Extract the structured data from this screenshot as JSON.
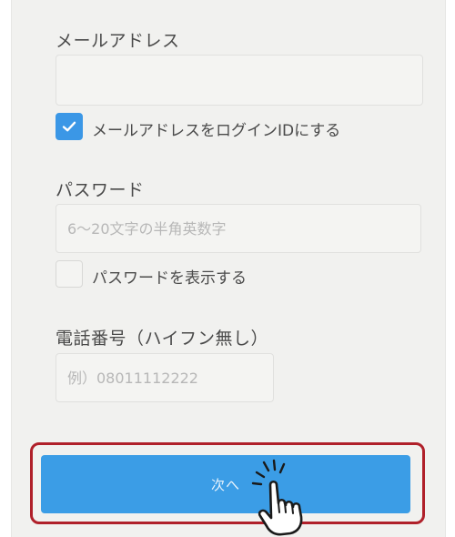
{
  "form": {
    "email_label": "メールアドレス",
    "email_value": "",
    "login_id_checkbox": {
      "checked": true,
      "label": "メールアドレスをログインIDにする"
    },
    "password_label": "パスワード",
    "password_placeholder": "6〜20文字の半角英数字",
    "show_password_checkbox": {
      "checked": false,
      "label": "パスワードを表示する"
    },
    "phone_label": "電話番号（ハイフン無し）",
    "phone_placeholder": "例）08011112222",
    "next_button_label": "次へ"
  },
  "colors": {
    "accent": "#3b97e6",
    "highlight_border": "#b0202a",
    "background": "#f1f1ef"
  },
  "icons": {
    "check": "check-icon",
    "pointer": "pointing-hand-icon"
  }
}
